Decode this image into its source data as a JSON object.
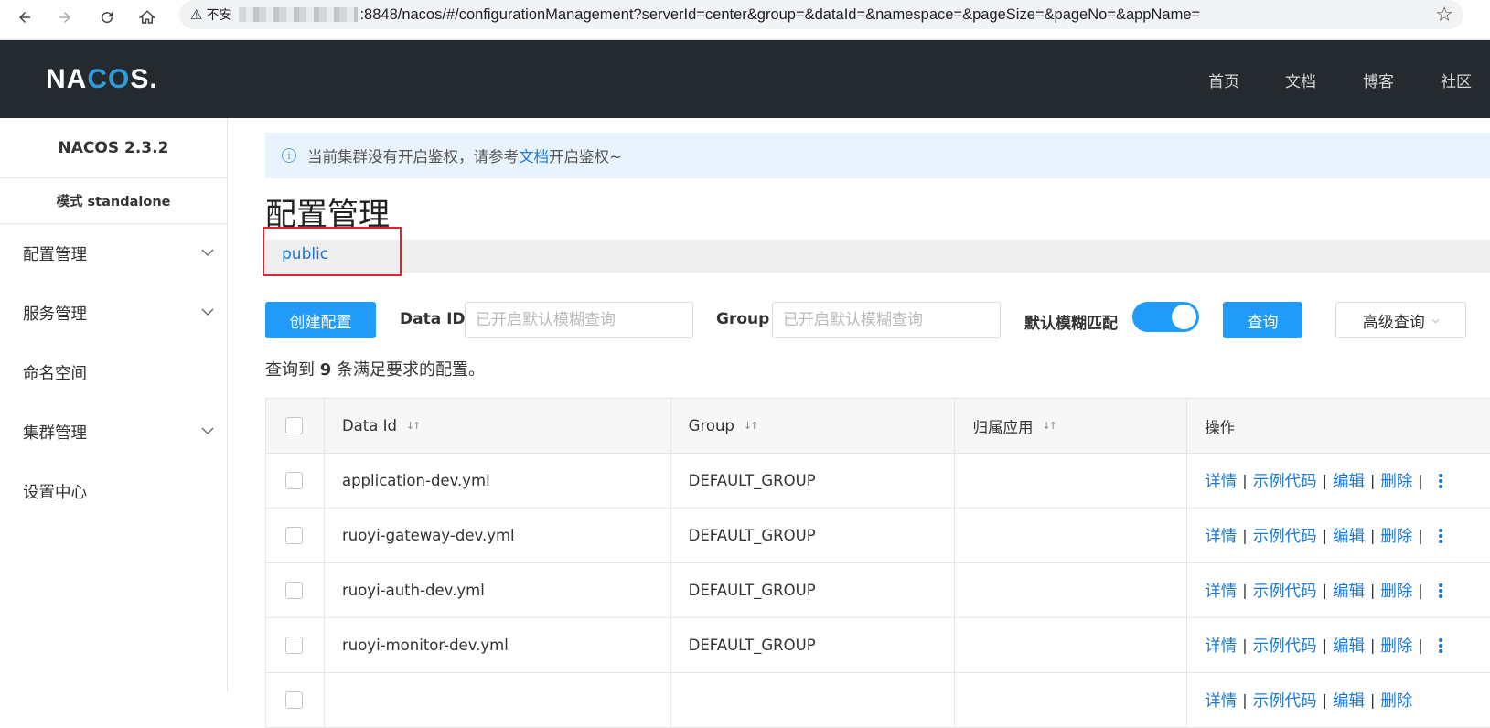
{
  "browser": {
    "insecure_label": "不安",
    "url_path": ":8848/nacos/#/configurationManagement?serverId=center&group=&dataId=&namespace=&pageSize=&pageNo=&appName="
  },
  "header": {
    "logo_left": "NA",
    "logo_mid": "CO",
    "logo_right": "S.",
    "nav": [
      "首页",
      "文档",
      "博客",
      "社区"
    ]
  },
  "sidebar": {
    "version": "NACOS 2.3.2",
    "mode": "模式 standalone",
    "items": [
      {
        "label": "配置管理",
        "expandable": true
      },
      {
        "label": "服务管理",
        "expandable": true
      },
      {
        "label": "命名空间",
        "expandable": false
      },
      {
        "label": "集群管理",
        "expandable": true
      },
      {
        "label": "设置中心",
        "expandable": false
      }
    ]
  },
  "notice": {
    "text_before": "当前集群没有开启鉴权，请参考",
    "link": "文档",
    "text_after": "开启鉴权~"
  },
  "page": {
    "title": "配置管理",
    "namespace": "public"
  },
  "toolbar": {
    "create_label": "创建配置",
    "dataid_label": "Data ID",
    "dataid_placeholder": "已开启默认模糊查询",
    "group_label": "Group",
    "group_placeholder": "已开启默认模糊查询",
    "fuzzy_label": "默认模糊匹配",
    "fuzzy_enabled": true,
    "search_label": "查询",
    "advanced_label": "高级查询"
  },
  "summary": {
    "prefix": "查询到",
    "count": "9",
    "suffix": "条满足要求的配置。"
  },
  "table": {
    "headers": [
      "Data Id",
      "Group",
      "归属应用",
      "操作"
    ],
    "rows": [
      {
        "data_id": "application-dev.yml",
        "group": "DEFAULT_GROUP",
        "app": ""
      },
      {
        "data_id": "ruoyi-gateway-dev.yml",
        "group": "DEFAULT_GROUP",
        "app": ""
      },
      {
        "data_id": "ruoyi-auth-dev.yml",
        "group": "DEFAULT_GROUP",
        "app": ""
      },
      {
        "data_id": "ruoyi-monitor-dev.yml",
        "group": "DEFAULT_GROUP",
        "app": ""
      }
    ],
    "actions": [
      "详情",
      "示例代码",
      "编辑",
      "删除"
    ]
  },
  "colors": {
    "header_bg": "#252a2f",
    "primary": "#209bfa",
    "link": "#1a78d7",
    "highlight": "#e0232b"
  }
}
